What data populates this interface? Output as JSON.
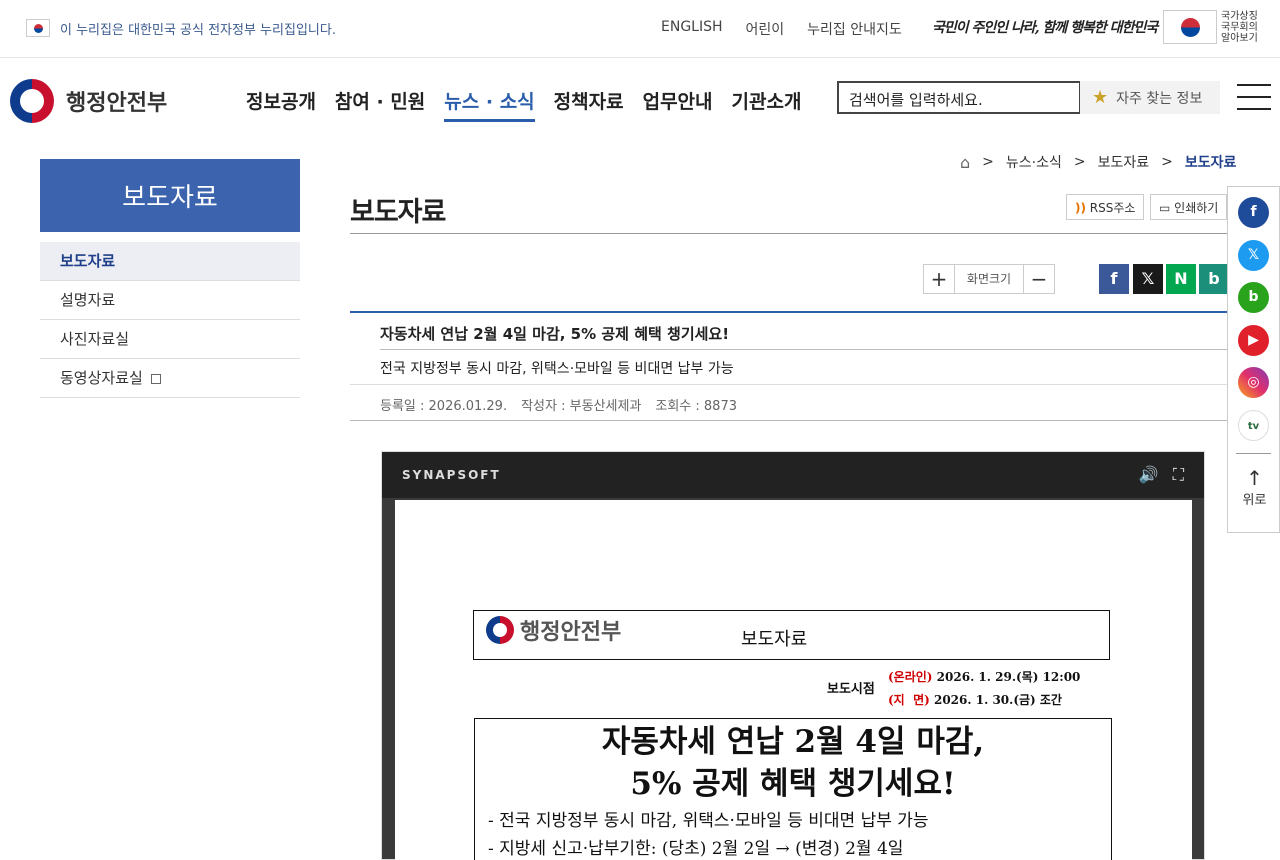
{
  "gov_banner": {
    "text": "이 누리집은 대한민국 공식 전자정부 누리집입니다.",
    "links": [
      "ENGLISH",
      "어린이",
      "누리집 안내지도"
    ],
    "slogan": "국민이 주인인 나라, 함께 행복한 대한민국",
    "cabinet": [
      "국가상징",
      "국무회의",
      "알아보기"
    ]
  },
  "header": {
    "logo": "행정안전부",
    "nav": [
      "정보공개",
      "참여 · 민원",
      "뉴스 · 소식",
      "정책자료",
      "업무안내",
      "기관소개"
    ],
    "nav_active_index": 2,
    "search_placeholder": "검색어를 입력하세요.",
    "favorites": "자주 찾는 정보"
  },
  "sidebar": {
    "title": "보도자료",
    "items": [
      "보도자료",
      "설명자료",
      "사진자료실",
      "동영상자료실"
    ],
    "active_index": 0
  },
  "breadcrumb": {
    "items": [
      "뉴스·소식",
      "보도자료",
      "보도자료"
    ],
    "separator": ">"
  },
  "page": {
    "title": "보도자료",
    "rss": "RSS주소",
    "print": "인쇄하기",
    "zoom_label": "화면크기"
  },
  "article": {
    "title": "자동차세 연납 2월 4일 마감, 5% 공제 혜택 챙기세요!",
    "subtitle": "전국 지방정부 동시 마감, 위택스·모바일 등 비대면 납부 가능",
    "meta": {
      "date": "등록일 : 2026.01.29.",
      "author": "작성자 : 부동산세제과",
      "views": "조회수 : 8873"
    }
  },
  "viewer": {
    "brand": "SYNAPSOFT",
    "doc": {
      "logo": "행정안전부",
      "label": "보도자료",
      "release_label": "보도시점",
      "release_online_tag": "(온라인)",
      "release_online": "2026. 1. 29.(목) 12:00",
      "release_paper_tag": "(지  면)",
      "release_paper": "2026. 1. 30.(금) 조간",
      "headline_1": "자동차세 연납 2월 4일 마감,",
      "headline_2": "5% 공제 혜택 챙기세요!",
      "bullet_1": "- 전국 지방정부 동시 마감, 위택스·모바일 등 비대면 납부 가능",
      "bullet_2": "- 지방세 신고·납부기한: (당초) 2월 2일 → (변경) 2월 4일"
    }
  },
  "side_social": {
    "to_top": "위로"
  },
  "colors": {
    "primary": "#2a5dab",
    "sidebar_title_bg": "#3c64ae",
    "release_red": "#d10000"
  }
}
